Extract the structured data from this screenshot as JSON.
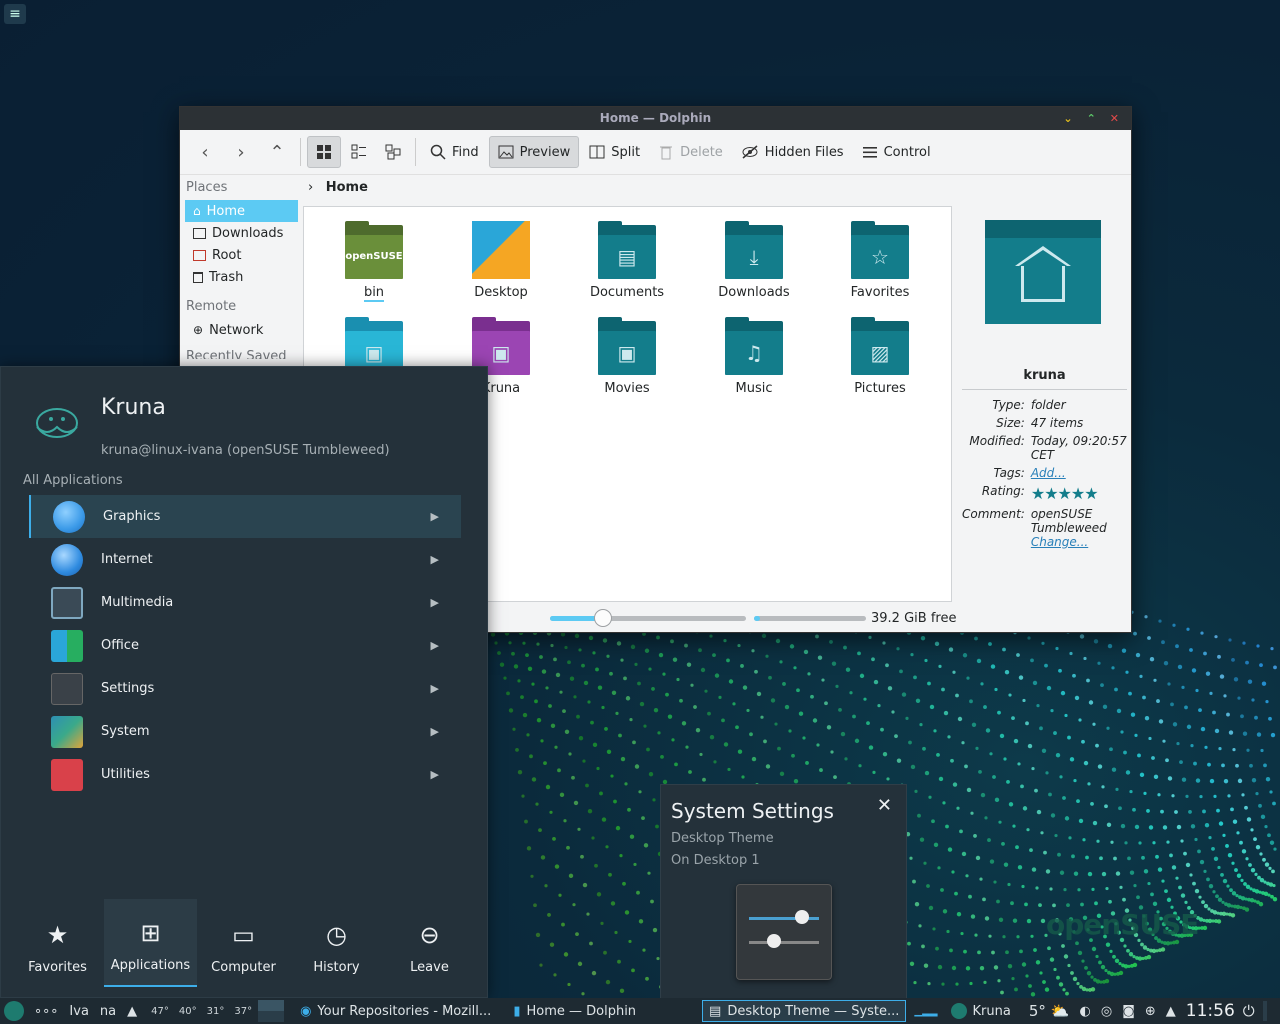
{
  "desktop": {
    "watermark": "openSUSE"
  },
  "dolphin": {
    "title": "Home — Dolphin",
    "toolbar": {
      "find": "Find",
      "preview": "Preview",
      "split": "Split",
      "delete": "Delete",
      "hidden_files": "Hidden Files",
      "control": "Control"
    },
    "places": {
      "header": "Places",
      "items": [
        "Home",
        "Downloads",
        "Root",
        "Trash"
      ],
      "remote_header": "Remote",
      "network": "Network",
      "recent_header": "Recently Saved"
    },
    "breadcrumb": "Home",
    "files": [
      {
        "name": "bin"
      },
      {
        "name": "Desktop"
      },
      {
        "name": "Documents"
      },
      {
        "name": "Downloads"
      },
      {
        "name": "Favorites"
      },
      {
        "name": ""
      },
      {
        "name": "Kruna"
      },
      {
        "name": "Movies"
      },
      {
        "name": "Music"
      },
      {
        "name": "Pictures"
      }
    ],
    "statusbar": {
      "free_space": "39.2 GiB free",
      "zoom_fraction": 0.27
    },
    "info_panel": {
      "name": "kruna",
      "type_label": "Type:",
      "type": "folder",
      "size_label": "Size:",
      "size": "47 items",
      "modified_label": "Modified:",
      "modified": "Today, 09:20:57 CET",
      "tags_label": "Tags:",
      "tags_action": "Add...",
      "rating_label": "Rating:",
      "rating": 5,
      "comment_label": "Comment:",
      "comment": "openSUSE Tumbleweed",
      "comment_action": "Change..."
    }
  },
  "launcher": {
    "user_name": "Kruna",
    "user_info": "kruna@linux-ivana (openSUSE Tumbleweed)",
    "section": "All Applications",
    "apps": [
      {
        "label": "Graphics",
        "color": "#3b9ae8"
      },
      {
        "label": "Internet",
        "color": "#2f8be0"
      },
      {
        "label": "Multimedia",
        "color": "#3a4a56"
      },
      {
        "label": "Office",
        "color": "#2aa6d8"
      },
      {
        "label": "Settings",
        "color": "#3a4148"
      },
      {
        "label": "System",
        "color": "#2d8fb3"
      },
      {
        "label": "Utilities",
        "color": "#d9414a"
      }
    ],
    "tabs": [
      "Favorites",
      "Applications",
      "Computer",
      "History",
      "Leave"
    ]
  },
  "notification": {
    "title": "System Settings",
    "line1": "Desktop Theme",
    "line2": "On Desktop 1"
  },
  "panel": {
    "activity": "Iva",
    "activity2": "na",
    "temps": [
      "47°",
      "40°",
      "31°",
      "37°"
    ],
    "tasks": [
      "Your Repositories - Mozill...",
      "Home — Dolphin",
      "Desktop Theme  — Syste..."
    ],
    "user": "Kruna",
    "weather": "5°",
    "clock": "11:56"
  }
}
